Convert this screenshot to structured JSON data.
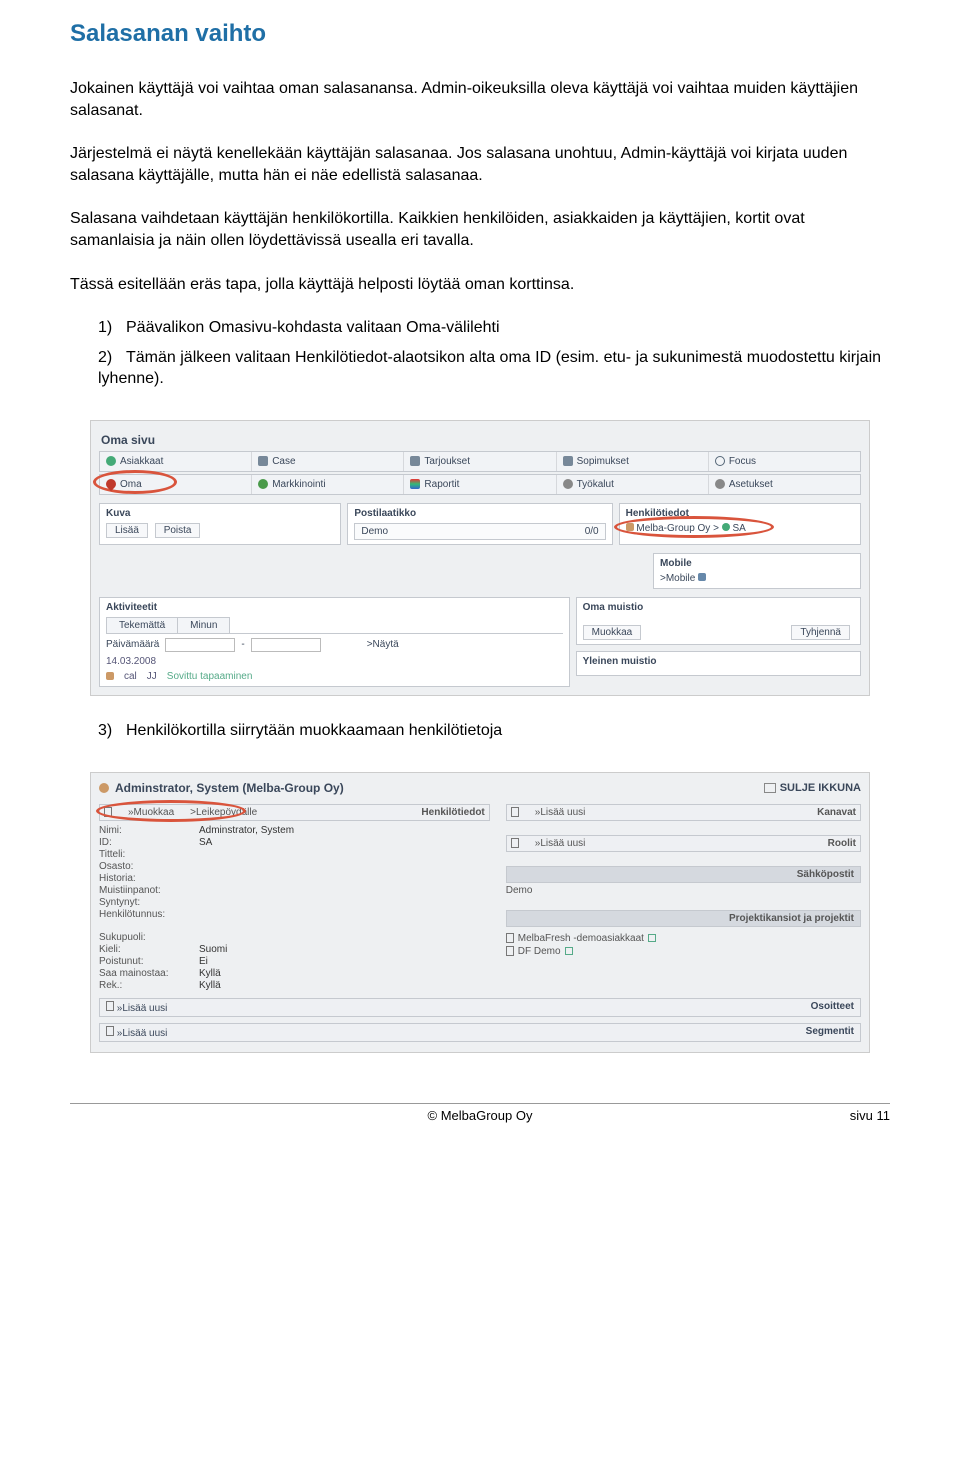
{
  "title": "Salasanan vaihto",
  "paragraphs": {
    "p1": "Jokainen käyttäjä voi vaihtaa oman salasanansa. Admin-oikeuksilla oleva käyttäjä voi vaihtaa muiden käyttäjien salasanat.",
    "p2": "Järjestelmä ei näytä kenellekään käyttäjän salasanaa. Jos salasana unohtuu, Admin-käyttäjä voi kirjata uuden salasana käyttäjälle, mutta hän ei näe edellistä salasanaa.",
    "p3": "Salasana vaihdetaan käyttäjän henkilökortilla. Kaikkien henkilöiden, asiakkaiden ja käyttäjien, kortit ovat samanlaisia ja näin ollen löydettävissä usealla eri tavalla.",
    "p4": "Tässä esitellään eräs tapa, jolla käyttäjä helposti löytää oman korttinsa."
  },
  "steps": {
    "s1": "Päävalikon Omasivu-kohdasta valitaan Oma-välilehti",
    "s2": "Tämän jälkeen valitaan Henkilötiedot-alaotsikon alta oma ID (esim. etu- ja sukunimestä muodostettu kirjain lyhenne).",
    "s3": "Henkilökortilla siirrytään muokkaamaan henkilötietoja"
  },
  "shot1": {
    "heading": "Oma sivu",
    "row1": [
      "Asiakkaat",
      "Case",
      "Tarjoukset",
      "Sopimukset",
      "Focus"
    ],
    "row2": [
      "Oma",
      "Markkinointi",
      "Raportit",
      "Työkalut",
      "Asetukset"
    ],
    "kuva": {
      "title": "Kuva",
      "btn_add": "Lisää",
      "btn_del": "Poista"
    },
    "post": {
      "title": "Postilaatikko",
      "name": "Demo",
      "count": "0/0"
    },
    "henkilo": {
      "title": "Henkilötiedot",
      "path": "Melba-Group Oy > ",
      "id": "SA"
    },
    "mobile": {
      "title": "Mobile",
      "link": ">Mobile"
    },
    "aktiv": {
      "title": "Aktiviteetit",
      "tab1": "Tekemättä",
      "tab2": "Minun",
      "date_lbl": "Päivämäärä",
      "show": ">Näytä",
      "date": "14.03.2008",
      "cal": "cal",
      "jj": "JJ",
      "text": "Sovittu tapaaminen"
    },
    "omamuistio": {
      "title": "Oma muistio",
      "btn1": "Muokkaa",
      "btn2": "Tyhjennä"
    },
    "yleinen": {
      "title": "Yleinen muistio"
    }
  },
  "shot2": {
    "header_name": "Adminstrator, System (Melba-Group Oy)",
    "close": "SULJE IKKUNA",
    "bar1": {
      "muokkaa": "»Muokkaa",
      "leike": ">Leikepöydälle",
      "henkilo": "Henkilötiedot"
    },
    "left_fields": [
      {
        "k": "Nimi:",
        "v": "Adminstrator, System"
      },
      {
        "k": "ID:",
        "v": "SA"
      },
      {
        "k": "Titteli:",
        "v": ""
      },
      {
        "k": "Osasto:",
        "v": ""
      },
      {
        "k": "Historia:",
        "v": ""
      },
      {
        "k": "Muistiinpanot:",
        "v": ""
      },
      {
        "k": "Syntynyt:",
        "v": ""
      },
      {
        "k": "Henkilötunnus:",
        "v": ""
      }
    ],
    "left_fields2": [
      {
        "k": "Sukupuoli:",
        "v": ""
      },
      {
        "k": "Kieli:",
        "v": "Suomi"
      },
      {
        "k": "Poistunut:",
        "v": "Ei"
      },
      {
        "k": "Saa mainostaa:",
        "v": "Kyllä"
      },
      {
        "k": "Rek.:",
        "v": "Kyllä"
      }
    ],
    "right_bars": [
      {
        "left": "»Lisää uusi",
        "right": "Kanavat"
      },
      {
        "left": "»Lisää uusi",
        "right": "Roolit"
      }
    ],
    "sahko": {
      "title": "Sähköpostit",
      "val": "Demo"
    },
    "proj": {
      "title": "Projektikansiot ja projektit",
      "items": [
        "MelbaFresh -demoasiakkaat",
        "DF Demo"
      ]
    },
    "bottom1": {
      "left": "»Lisää uusi",
      "right": "Osoitteet"
    },
    "bottom2": {
      "left": "»Lisää uusi",
      "right": "Segmentit"
    }
  },
  "footer": {
    "copyright": "© MelbaGroup Oy",
    "page": "sivu 11"
  }
}
